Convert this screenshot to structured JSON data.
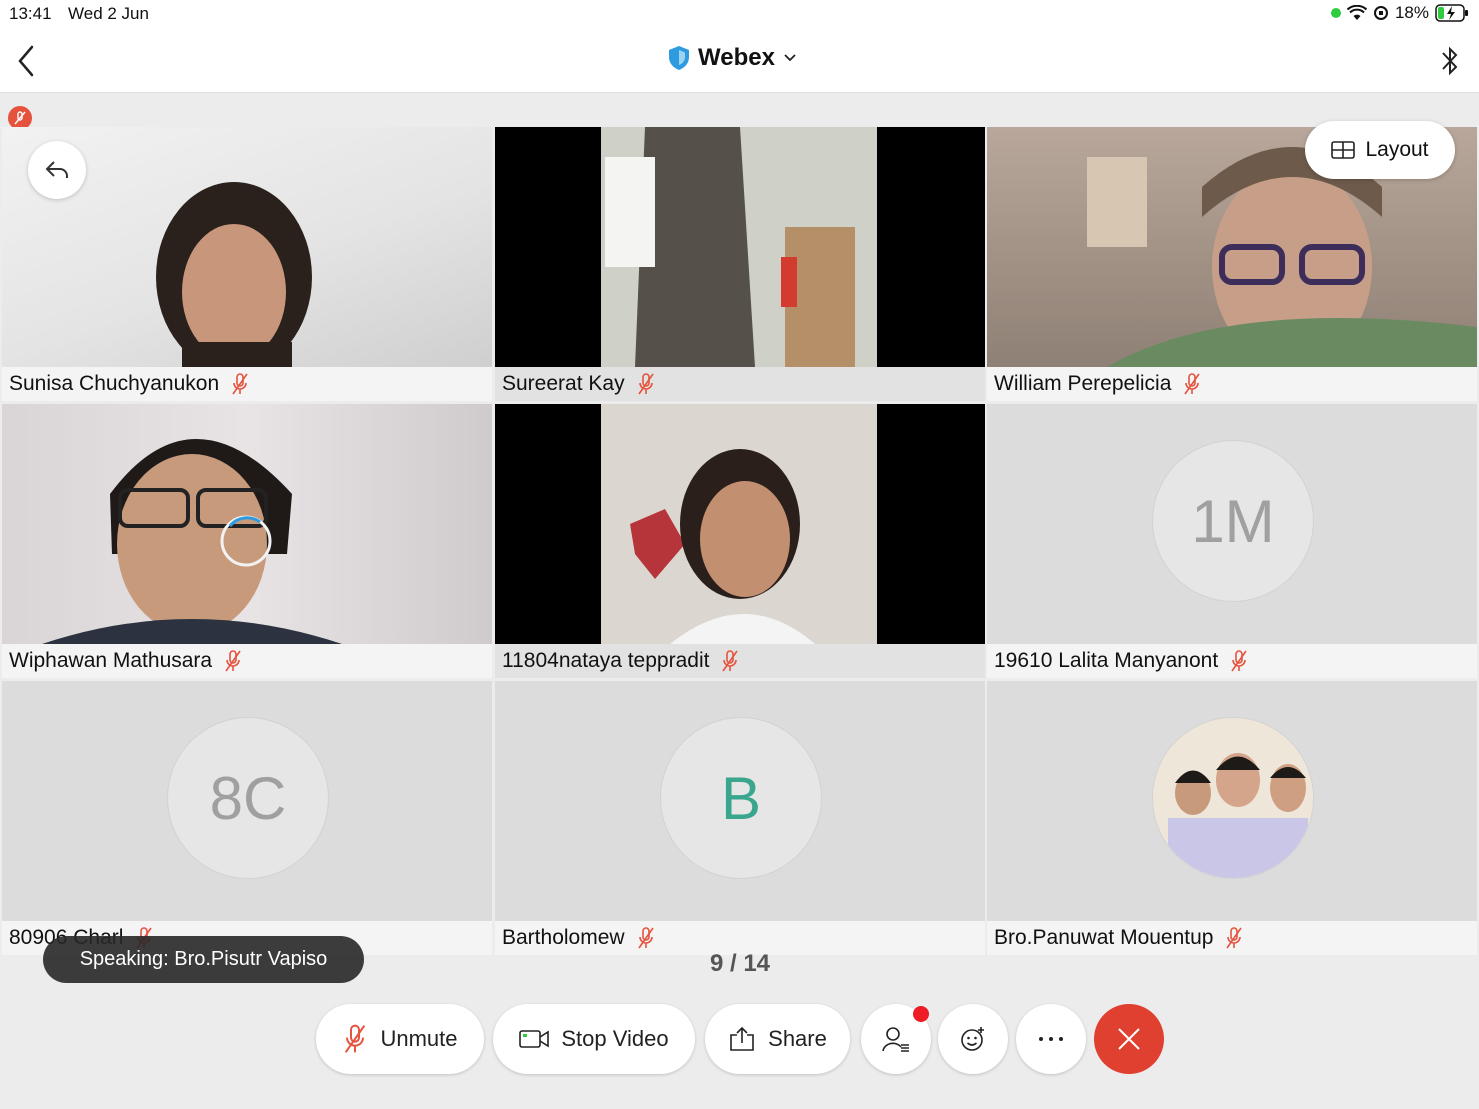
{
  "status_bar": {
    "time": "13:41",
    "date": "Wed 2 Jun",
    "battery": "18%"
  },
  "nav": {
    "title": "Webex"
  },
  "layout_button": {
    "label": "Layout"
  },
  "participants": [
    {
      "name": "Sunisa Chuchyanukon",
      "video": true
    },
    {
      "name": "Sureerat Kay",
      "video": true
    },
    {
      "name": "William Perepelicia",
      "video": true
    },
    {
      "name": "Wiphawan Mathusara",
      "video": true
    },
    {
      "name": "11804nataya teppradit",
      "video": true
    },
    {
      "name": "19610 Lalita Manyanont",
      "initials": "1M"
    },
    {
      "name": "80906 Charl",
      "initials": "8C"
    },
    {
      "name": "Bartholomew",
      "initials": "B"
    },
    {
      "name": "Bro.Panuwat Mouentup",
      "photo": true
    }
  ],
  "speaking": "Speaking: Bro.Pisutr Vapiso",
  "page_indicator": "9 / 14",
  "controls": {
    "unmute": "Unmute",
    "stop_video": "Stop Video",
    "share": "Share"
  },
  "colors": {
    "muted_red": "#e5533e",
    "end_call": "#e0402f",
    "initial_b": "#3aa68e"
  }
}
